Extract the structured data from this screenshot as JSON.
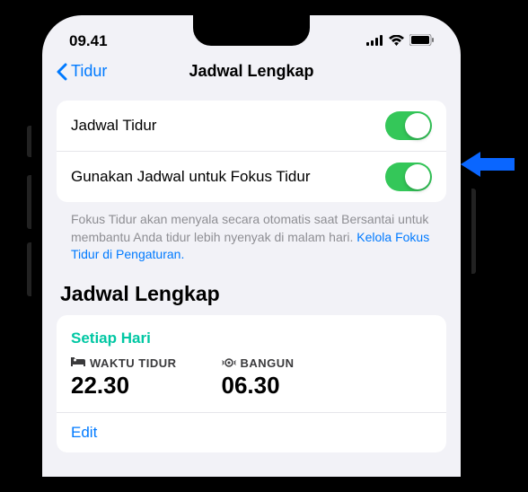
{
  "status": {
    "time": "09.41"
  },
  "nav": {
    "back": "Tidur",
    "title": "Jadwal Lengkap"
  },
  "toggles": {
    "sleep_schedule": {
      "label": "Jadwal Tidur"
    },
    "use_for_focus": {
      "label": "Gunakan Jadwal untuk Fokus Tidur"
    }
  },
  "footer": {
    "text": "Fokus Tidur akan menyala secara otomatis saat Bersantai untuk membantu Anda tidur lebih nyenyak di malam hari. ",
    "link": "Kelola Fokus Tidur di Pengaturan."
  },
  "section_title": "Jadwal Lengkap",
  "schedule": {
    "frequency": "Setiap Hari",
    "bedtime": {
      "label": "WAKTU TIDUR",
      "value": "22.30"
    },
    "wake": {
      "label": "BANGUN",
      "value": "06.30"
    },
    "edit": "Edit"
  }
}
